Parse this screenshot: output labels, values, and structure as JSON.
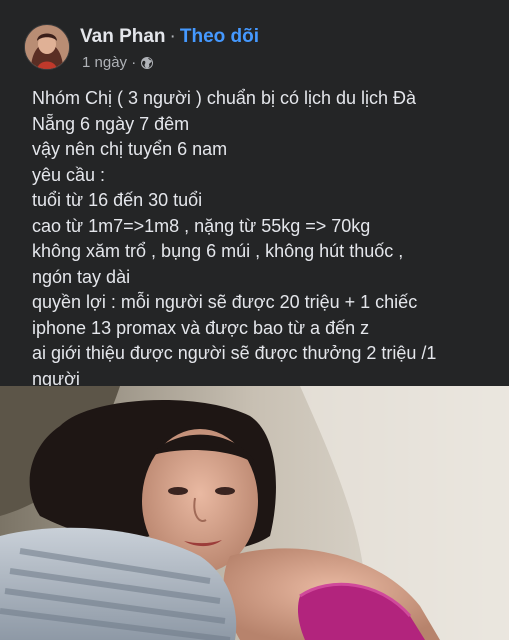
{
  "post": {
    "author": "Van Phan",
    "separator": "·",
    "follow_label": "Theo dõi",
    "timestamp": "1 ngày ·",
    "privacy_icon": "globe-icon",
    "lines": [
      "Nhóm Chị  ( 3 người ) chuẩn bị có lịch du lịch Đà",
      "Nẵng 6 ngày 7 đêm",
      "vậy nên chị tuyển 6 nam",
      "yêu cầu :",
      "tuổi từ 16 đến 30 tuổi",
      "cao từ 1m7=>1m8 , nặng từ 55kg => 70kg",
      "không xăm trổ , bụng 6 múi  , không hút thuốc ,",
      "ngón tay dài",
      "quyền lợi : mỗi người sẽ được 20 triệu + 1 chiếc",
      "iphone 13 promax và được bao từ a đến z",
      "ai giới thiệu được người sẽ được thưởng 2 triệu /1",
      "người"
    ]
  },
  "colors": {
    "background": "#242526",
    "text": "#e4e6eb",
    "secondary_text": "#b0b3b8",
    "link": "#4599ff"
  }
}
